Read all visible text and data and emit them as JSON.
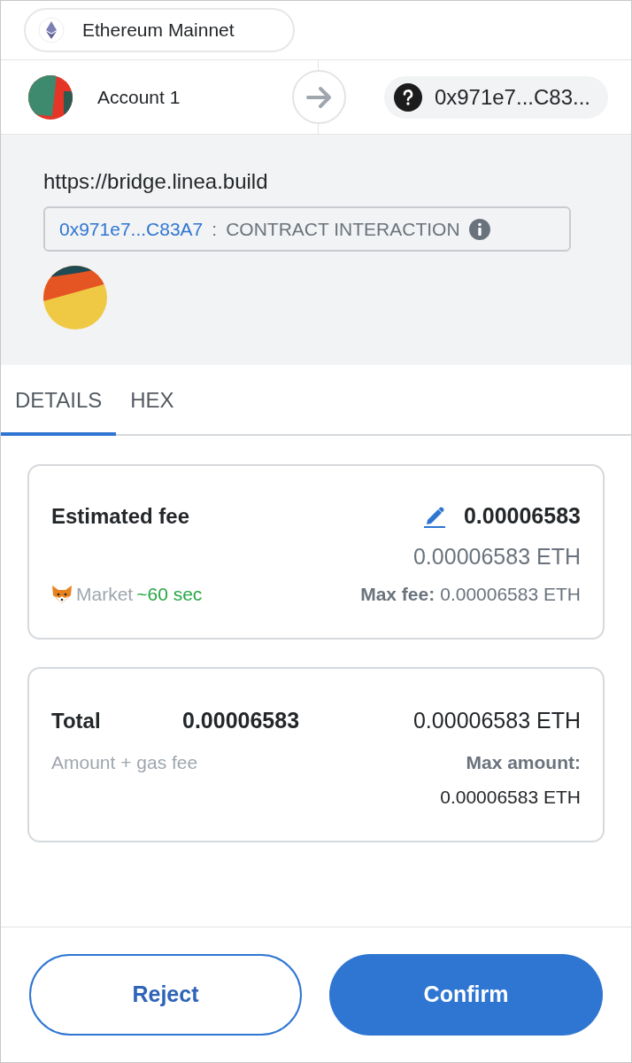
{
  "network": {
    "label": "Ethereum Mainnet"
  },
  "sender": {
    "name": "Account 1"
  },
  "recipient": {
    "address": "0x971e7...C83..."
  },
  "origin": "https://bridge.linea.build",
  "contract": {
    "address": "0x971e7...C83A7",
    "separator": ":",
    "method": "CONTRACT INTERACTION"
  },
  "tabs": [
    {
      "label": "DETAILS",
      "selected": true
    },
    {
      "label": "HEX",
      "selected": false
    }
  ],
  "fee": {
    "label": "Estimated fee",
    "primary": "0.00006583",
    "secondary": "0.00006583 ETH",
    "speed": "Market",
    "time": "~60 sec",
    "max_label": "Max fee:",
    "max_value": "0.00006583 ETH"
  },
  "total": {
    "label": "Total",
    "primary": "0.00006583",
    "secondary": "0.00006583 ETH",
    "hint": "Amount + gas fee",
    "max_label": "Max amount:",
    "max_value": "0.00006583 ETH"
  },
  "buttons": [
    {
      "label": "Reject",
      "kind": "secondary"
    },
    {
      "label": "Confirm",
      "kind": "primary"
    }
  ]
}
